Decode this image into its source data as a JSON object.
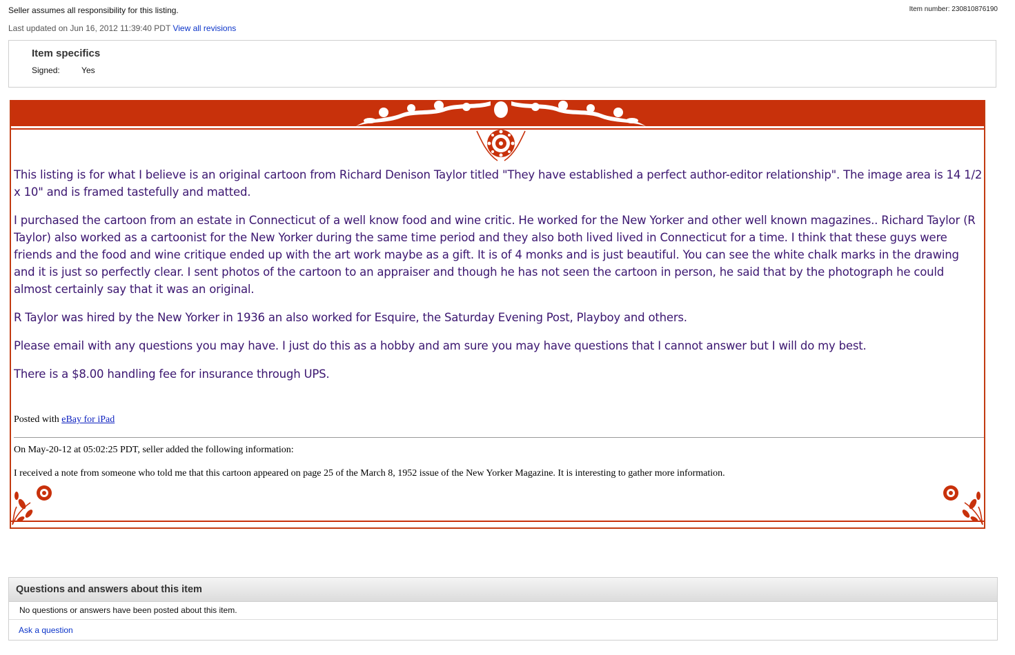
{
  "header": {
    "seller_note": "Seller assumes all responsibility for this listing.",
    "last_updated_prefix": "Last updated on",
    "last_updated_value": "Jun 16, 2012 11:39:40 PDT",
    "view_revisions": "View all revisions",
    "item_number": "Item number: 230810876190"
  },
  "specifics": {
    "title": "Item specifics",
    "label": "Signed:",
    "value": "Yes"
  },
  "description": {
    "paragraphs": [
      "This listing is for what I believe is an original cartoon from Richard Denison Taylor titled \"They have  established a perfect author-editor relationship\".   The image area is 14 1/2 x 10\" and is framed tastefully and matted.",
      "I purchased the cartoon from an estate in Connecticut of a well know food and wine critic.  He worked for the New Yorker and other well known magazines..  Richard Taylor (R Taylor) also worked as a cartoonist  for the New Yorker during the same time period and they also both lived lived in Connecticut for a time.  I think that these guys were friends and the food and wine critique ended up with the art work maybe as a gift.  It is of 4 monks and is just beautiful.  You can see the white chalk marks in the drawing and it is just so perfectly clear.  I sent photos of the cartoon to an appraiser and though he has not seen the cartoon in person, he said that by the photograph he could almost certainly say that it was an original.",
      " R Taylor was hired by the New Yorker in 1936 an also worked for Esquire, the Saturday Evening Post, Playboy and others.",
      "Please email with any questions you may have.  I just do this as a hobby and am sure you may have questions that I cannot answer but I will do my best.",
      "There is a $8.00 handling fee for insurance through UPS."
    ],
    "posted_prefix": "Posted with",
    "posted_link": "eBay for iPad",
    "added_heading": "On May-20-12 at 05:02:25 PDT, seller added the following information:",
    "added_body": "I received a note from someone who told me that this cartoon appeared on page 25 of the March 8, 1952 issue of the New Yorker Magazine. It is interesting to gather more information."
  },
  "qa": {
    "title": "Questions and answers about this item",
    "empty": "No questions or answers have been posted about this item.",
    "ask": "Ask a question"
  },
  "colors": {
    "frame": "#c8310b",
    "text_purple": "#3b1670",
    "link": "#0b34c9"
  }
}
